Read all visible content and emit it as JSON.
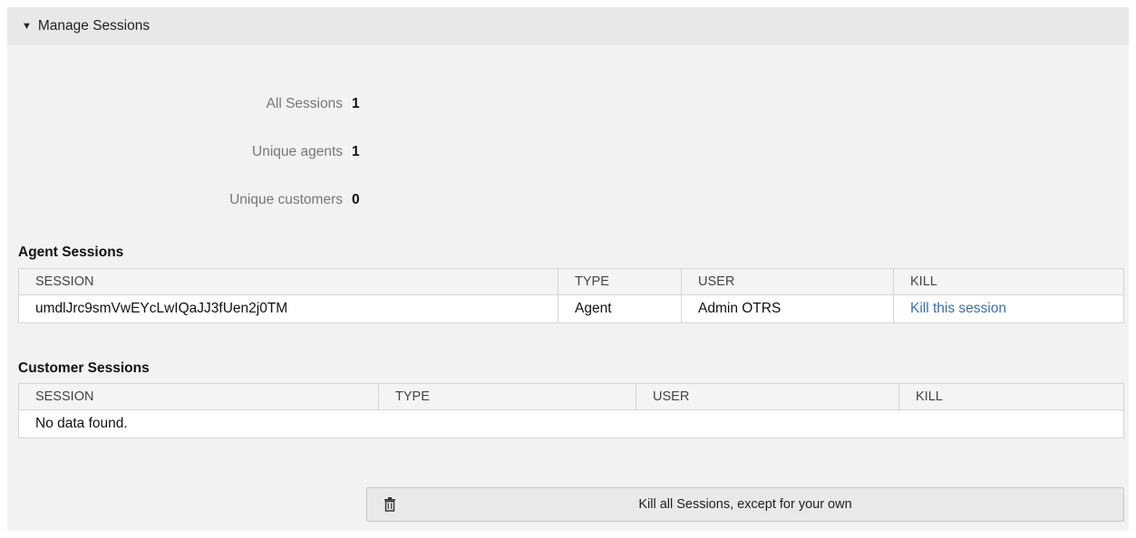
{
  "panel": {
    "title": "Manage Sessions"
  },
  "stats": [
    {
      "label": "All Sessions",
      "value": "1"
    },
    {
      "label": "Unique agents",
      "value": "1"
    },
    {
      "label": "Unique customers",
      "value": "0"
    }
  ],
  "agent_sessions": {
    "title": "Agent Sessions",
    "headers": [
      "SESSION",
      "TYPE",
      "USER",
      "KILL"
    ],
    "rows": [
      {
        "session": "umdlJrc9smVwEYcLwIQaJJ3fUen2j0TM",
        "type": "Agent",
        "user": "Admin OTRS",
        "kill": "Kill this session"
      }
    ]
  },
  "customer_sessions": {
    "title": "Customer Sessions",
    "headers": [
      "SESSION",
      "TYPE",
      "USER",
      "KILL"
    ],
    "empty": "No data found."
  },
  "kill_all_button": {
    "label": "Kill all Sessions, except for your own",
    "icon": "trash-icon"
  },
  "colors": {
    "link": "#3a6fa8",
    "panel_bg": "#f2f2f2",
    "header_bg": "#e8e8e8"
  }
}
